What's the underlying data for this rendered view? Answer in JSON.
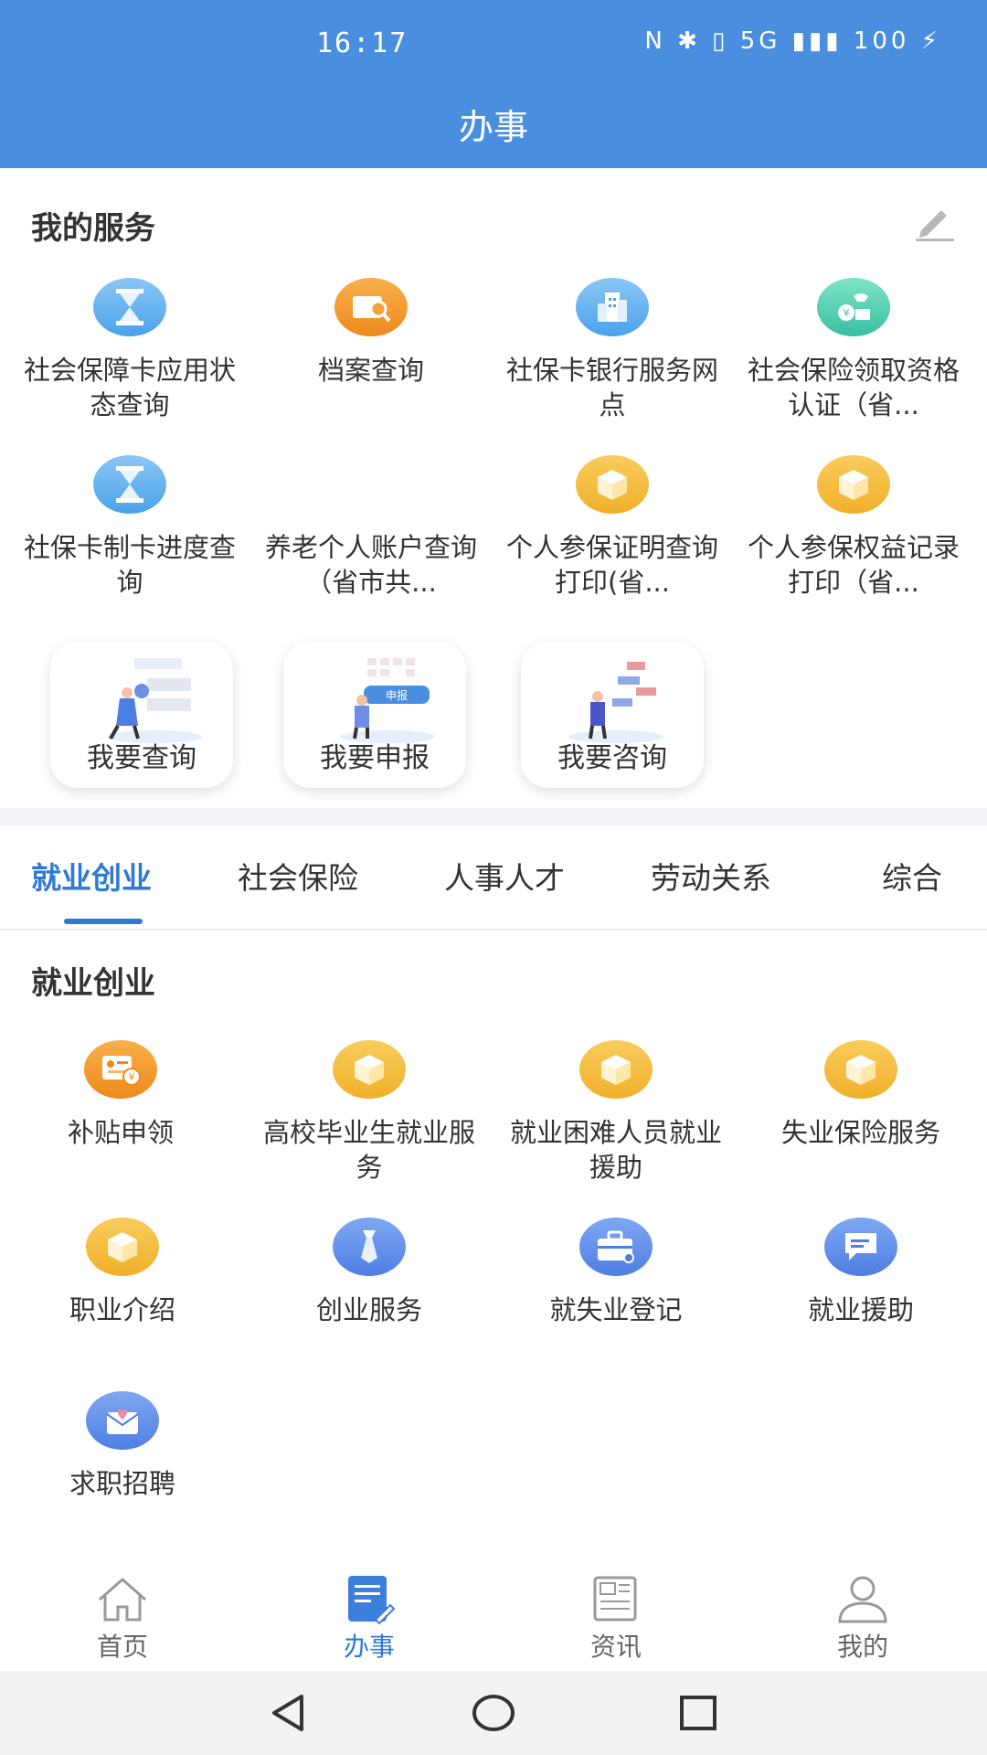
{
  "status_bar": {
    "time": "16:17",
    "icons": "N ✱ ▯ 5G ▮▮▮ 100 ⚡",
    "battery": "100"
  },
  "header": {
    "title": "办事"
  },
  "my_services": {
    "title": "我的服务",
    "items": [
      {
        "label": "社会保障卡应用状态查询",
        "icon": "hourglass-icon"
      },
      {
        "label": "档案查询",
        "icon": "folder-search-icon"
      },
      {
        "label": "社保卡银行服务网点",
        "icon": "building-icon"
      },
      {
        "label": "社会保险领取资格认证（省...",
        "icon": "pension-hand-icon"
      },
      {
        "label": "社保卡制卡进度查询",
        "icon": "hourglass-icon"
      },
      {
        "label": "养老个人账户查询（省市共...",
        "icon": "none"
      },
      {
        "label": "个人参保证明查询打印(省...",
        "icon": "box-icon"
      },
      {
        "label": "个人参保权益记录打印（省...",
        "icon": "box-icon"
      }
    ]
  },
  "quick_cards": [
    {
      "label": "我要查询"
    },
    {
      "label": "我要申报",
      "tag": "申报"
    },
    {
      "label": "我要咨询"
    }
  ],
  "tabs": [
    "就业创业",
    "社会保险",
    "人事人才",
    "劳动关系",
    "综合"
  ],
  "active_tab": "就业创业",
  "category": {
    "title": "就业创业",
    "items": [
      {
        "label": "补贴申领",
        "icon": "subsidy-card-icon"
      },
      {
        "label": "高校毕业生就业服务",
        "icon": "box-icon"
      },
      {
        "label": "就业困难人员就业援助",
        "icon": "box-icon"
      },
      {
        "label": "失业保险服务",
        "icon": "box-icon"
      },
      {
        "label": "职业介绍",
        "icon": "box-icon"
      },
      {
        "label": "创业服务",
        "icon": "tie-icon"
      },
      {
        "label": "就失业登记",
        "icon": "briefcase-icon"
      },
      {
        "label": "就业援助",
        "icon": "chat-icon"
      },
      {
        "label": "求职招聘",
        "icon": "heart-envelope-icon"
      }
    ]
  },
  "bottom_nav": [
    {
      "label": "首页",
      "icon": "home-icon"
    },
    {
      "label": "办事",
      "icon": "doc-edit-icon"
    },
    {
      "label": "资讯",
      "icon": "news-icon"
    },
    {
      "label": "我的",
      "icon": "person-icon"
    }
  ],
  "colors": {
    "header_bg": "#4a8fdf",
    "accent": "#2f79d6",
    "icon_yellow": "#f0b02a"
  }
}
